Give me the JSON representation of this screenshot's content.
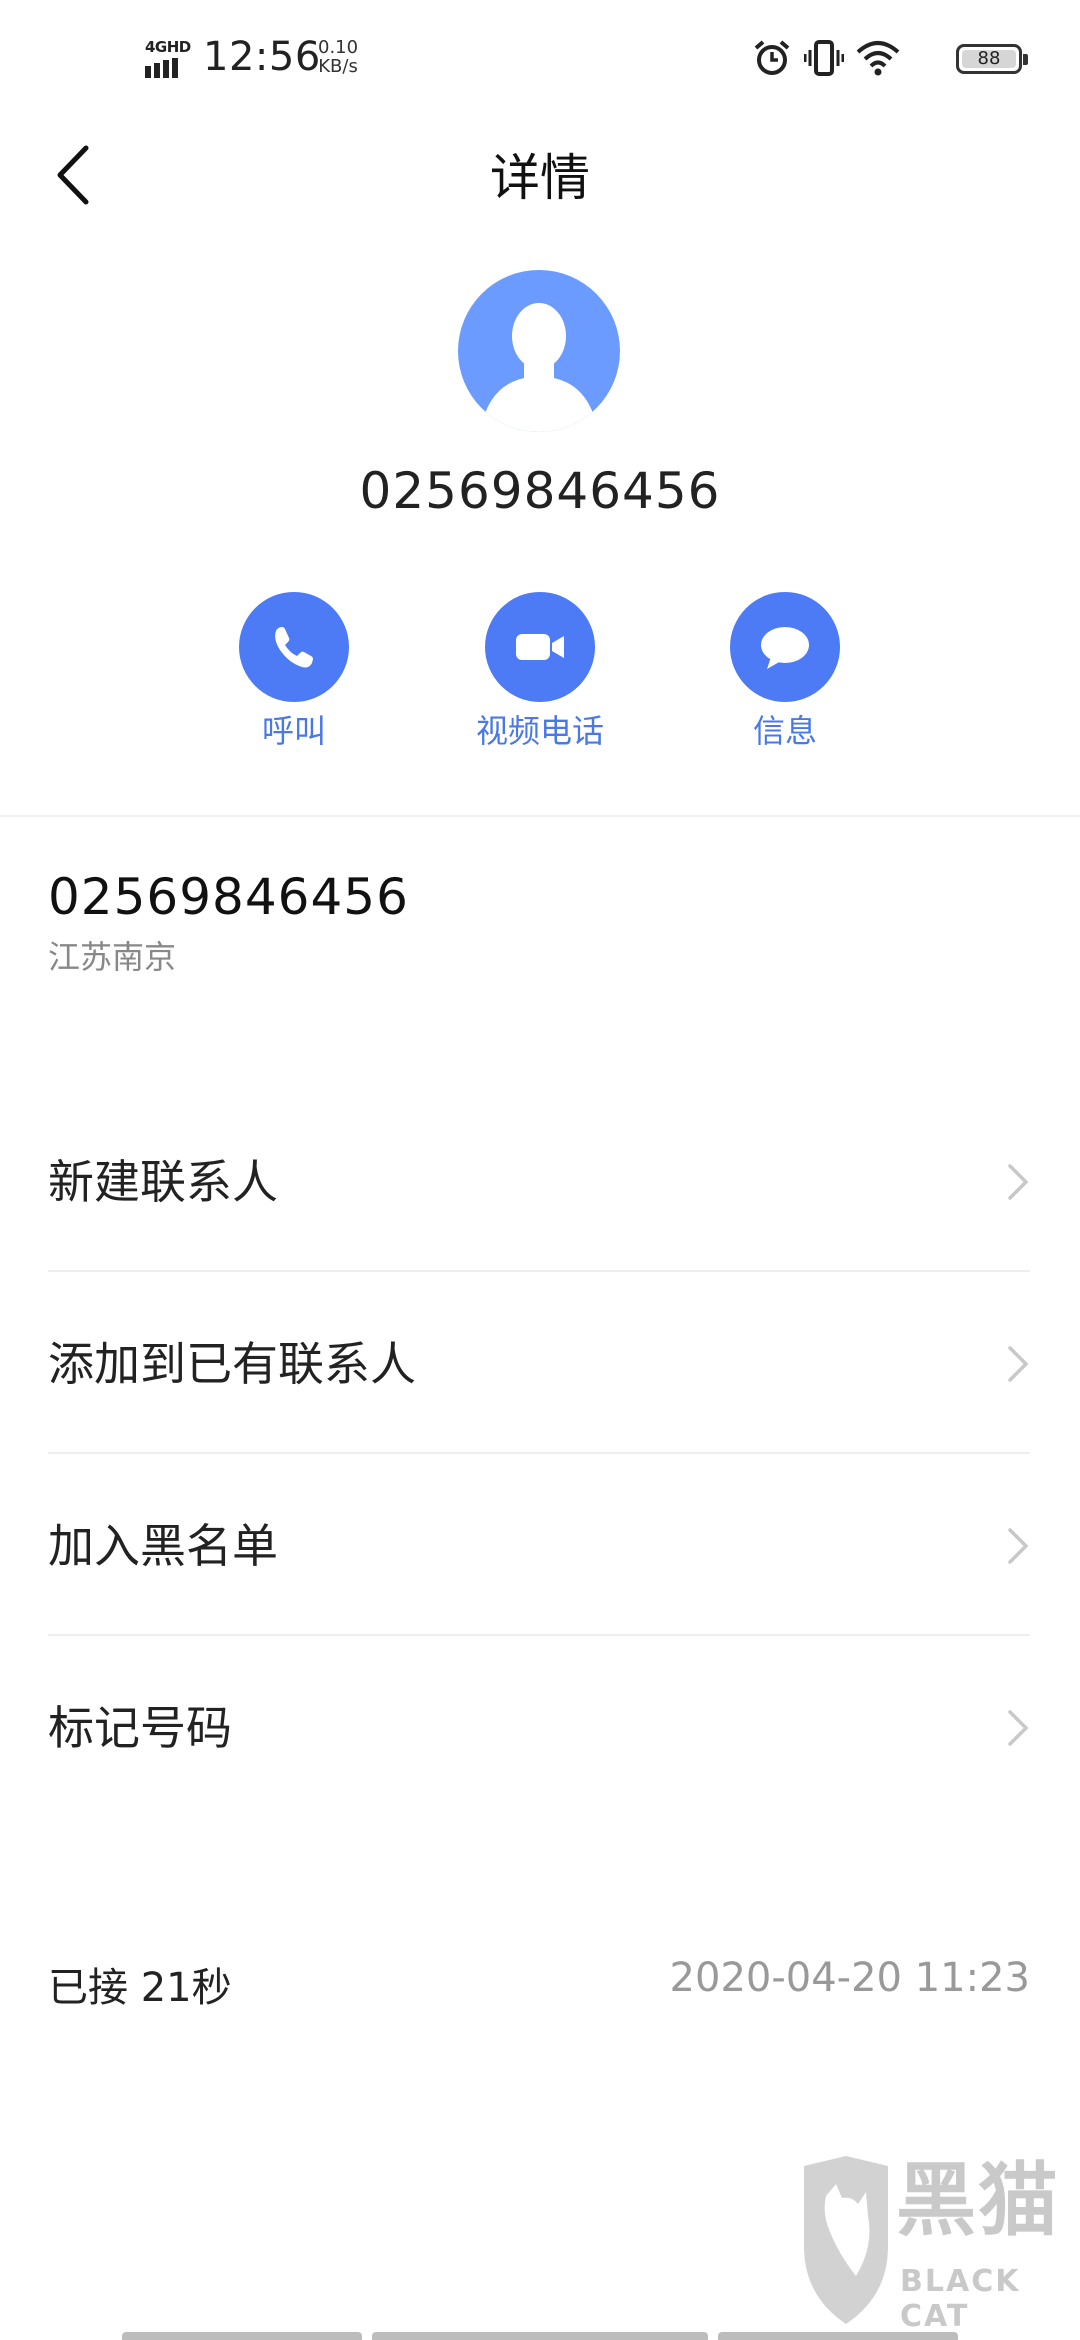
{
  "status_bar": {
    "network": "4GHD",
    "time": "12:56",
    "speed_value": "0.10",
    "speed_unit": "KB/s",
    "battery": "88",
    "icons": [
      "alarm-icon",
      "vibrate-icon",
      "wifi-icon",
      "battery-icon"
    ]
  },
  "header": {
    "title": "详情",
    "back_icon": "chevron-left-icon"
  },
  "contact": {
    "number": "02569846456"
  },
  "actions": [
    {
      "label": "呼叫",
      "icon": "phone-icon"
    },
    {
      "label": "视频电话",
      "icon": "video-camera-icon"
    },
    {
      "label": "信息",
      "icon": "message-icon"
    }
  ],
  "number_info": {
    "number": "02569846456",
    "location": "江苏南京"
  },
  "menu": [
    {
      "label": "新建联系人"
    },
    {
      "label": "添加到已有联系人"
    },
    {
      "label": "加入黑名单"
    },
    {
      "label": "标记号码"
    }
  ],
  "call_log": {
    "status": "已接 21秒",
    "datetime": "2020-04-20 11:23"
  },
  "watermark": {
    "cn": "黑猫",
    "en": "BLACK CAT"
  },
  "colors": {
    "accent": "#4c7bf5",
    "avatar": "#6b9bff",
    "action_label": "#4a79e6"
  }
}
